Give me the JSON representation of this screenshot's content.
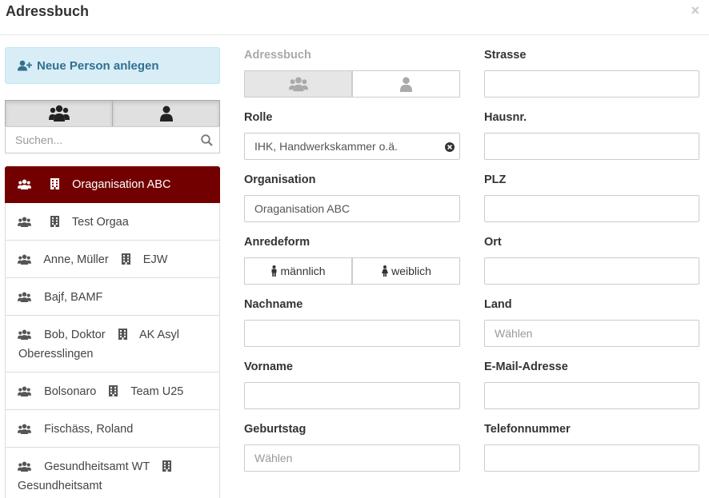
{
  "dialog": {
    "title": "Adressbuch",
    "close": "×"
  },
  "sidebar": {
    "new_person": "Neue Person anlegen",
    "search_placeholder": "Suchen...",
    "items": [
      {
        "name": "Oraganisation ABC",
        "org": "",
        "org_icon": true,
        "person_icon": true
      },
      {
        "name": "Test Orgaa",
        "org": "",
        "org_icon": true
      },
      {
        "name": "Anne, Müller",
        "org": "EJW",
        "org_icon": true
      },
      {
        "name": "Bajf, BAMF",
        "org": "",
        "org_icon": false
      },
      {
        "name": "Bob, Doktor",
        "org": "AK Asyl",
        "line2": "Oberesslingen",
        "org_icon": true
      },
      {
        "name": "Bolsonaro",
        "org": "Team U25",
        "org_icon": true
      },
      {
        "name": "Fischäss, Roland",
        "org": "",
        "org_icon": false
      },
      {
        "name": "Gesundheitsamt WT",
        "org": "",
        "line2": "Gesundheitsamt",
        "org_icon": true
      }
    ]
  },
  "form": {
    "adressbuch_label": "Adressbuch",
    "rolle_label": "Rolle",
    "rolle_value": "IHK, Handwerkskammer o.ä.",
    "organisation_label": "Organisation",
    "organisation_value": "Oraganisation ABC",
    "anrede_label": "Anredeform",
    "male": "männlich",
    "female": "weiblich",
    "nachname_label": "Nachname",
    "vorname_label": "Vorname",
    "geburtstag_label": "Geburtstag",
    "geburtstag_placeholder": "Wählen",
    "strasse_label": "Strasse",
    "hausnr_label": "Hausnr.",
    "plz_label": "PLZ",
    "ort_label": "Ort",
    "land_label": "Land",
    "land_placeholder": "Wählen",
    "email_label": "E-Mail-Adresse",
    "telefon_label": "Telefonnummer"
  },
  "colors": {
    "active": "#720000",
    "info_bg": "#d9edf7",
    "info_text": "#31708f"
  }
}
